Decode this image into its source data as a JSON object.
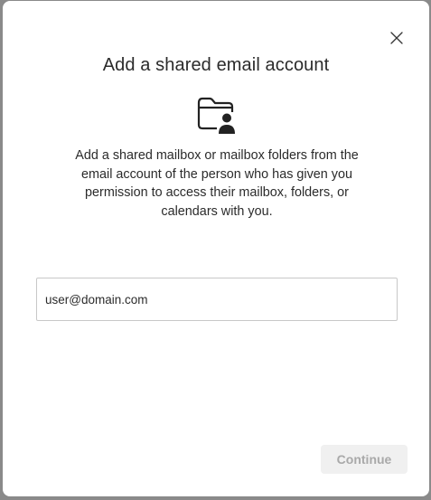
{
  "dialog": {
    "title": "Add a shared email account",
    "description": "Add a shared mailbox or mailbox folders from the email account of the person who has given you permission to access their mailbox, folders, or calendars with you.",
    "icons": {
      "close": "close-icon",
      "hero": "shared-folder-person-icon"
    },
    "email_input": {
      "value": "",
      "placeholder": "user@domain.com"
    },
    "continue_label": "Continue",
    "continue_enabled": false
  }
}
